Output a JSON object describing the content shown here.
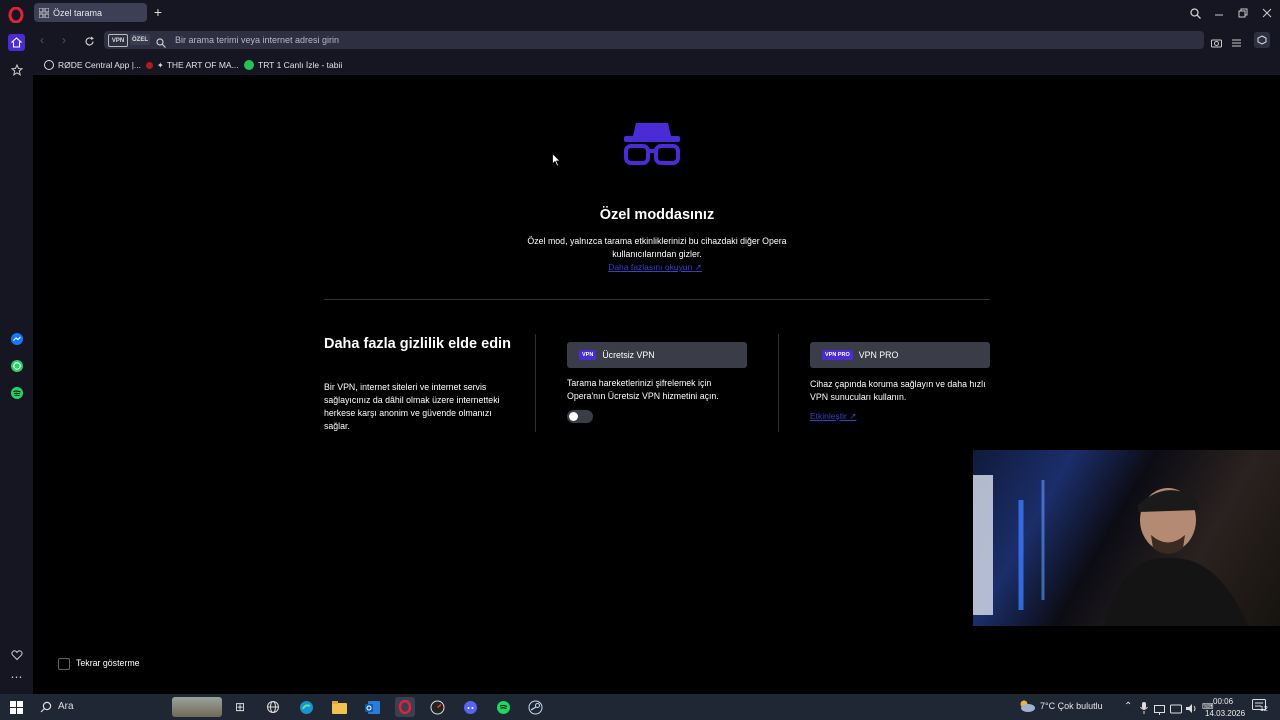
{
  "tab": {
    "title": "Özel tarama"
  },
  "addressbar": {
    "vpn_badge": "VPN",
    "private_badge": "ÖZEL",
    "placeholder": "Bir arama terimi veya internet adresi girin"
  },
  "bookmarks": [
    {
      "label": "RØDE Central App |...",
      "icon": "rode-icon"
    },
    {
      "label": "THE ART OF MA...",
      "icon": "art-icon"
    },
    {
      "label": "TRT 1 Canlı İzle - tabii",
      "icon": "trt-icon"
    }
  ],
  "main": {
    "heading": "Özel moddasınız",
    "description": "Özel mod, yalnızca tarama etkinliklerinizi bu cihazdaki diğer Opera kullanıcılarından gizler.",
    "learn_more": "Daha fazlasını okuyun",
    "privacy_title": "Daha fazla gizlilik elde edin",
    "privacy_text": "Bir VPN, internet siteleri ve internet servis sağlayıcınız da dâhil olmak üzere internetteki herkese karşı anonim ve güvende olmanızı sağlar.",
    "free_vpn": {
      "tag": "VPN",
      "label": "Ücretsiz VPN",
      "text": "Tarama hareketlerinizi şifrelemek için Opera'nın Ücretsiz VPN hizmetini açın.",
      "enabled": false
    },
    "vpn_pro": {
      "tag": "VPN PRO",
      "label": "VPN PRO",
      "text": "Cihaz çapında koruma sağlayın ve daha hızlı VPN sunucuları kullanın.",
      "activate": "Etkinleştir"
    },
    "dont_show_again": "Tekrar gösterme"
  },
  "taskbar": {
    "search_label": "Ara",
    "weather": "7°C  Çok bulutlu",
    "time": "00:06",
    "date": "14.03.2026",
    "notifications": "12"
  },
  "colors": {
    "accent": "#4b2bd6",
    "link": "#3b3ec9",
    "chrome": "#151621"
  }
}
